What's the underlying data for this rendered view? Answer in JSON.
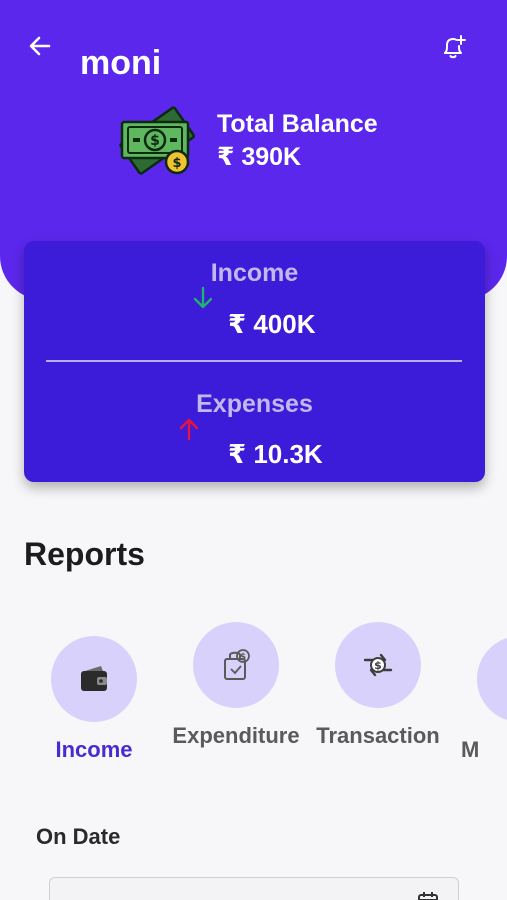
{
  "header": {
    "title": "moni",
    "balance_label": "Total Balance",
    "balance_value": "₹ 390K",
    "back_icon": "arrow-left-icon",
    "bell_icon": "bell-add-icon",
    "money_icon": "money-bill-icon"
  },
  "summary": {
    "income_label": "Income",
    "income_value": "₹ 400K",
    "expenses_label": "Expenses",
    "expenses_value": "₹ 10.3K",
    "income_arrow_color": "#1fb36b",
    "expense_arrow_color": "#e8143c"
  },
  "reports": {
    "title": "Reports",
    "items": [
      {
        "label": "Income",
        "icon": "wallet-icon",
        "active": true
      },
      {
        "label": "Expenditure",
        "icon": "shopping-bag-icon",
        "active": false
      },
      {
        "label": "Transaction",
        "icon": "exchange-icon",
        "active": false
      },
      {
        "label": "M",
        "icon": "more-icon",
        "active": false
      }
    ]
  },
  "filter": {
    "on_date_label": "On Date",
    "date_value": ""
  },
  "colors": {
    "header_bg": "#5b27ec",
    "card_bg": "#3d1cd9",
    "accent": "#4a2bd1",
    "circle_bg": "#d8d1fb"
  }
}
